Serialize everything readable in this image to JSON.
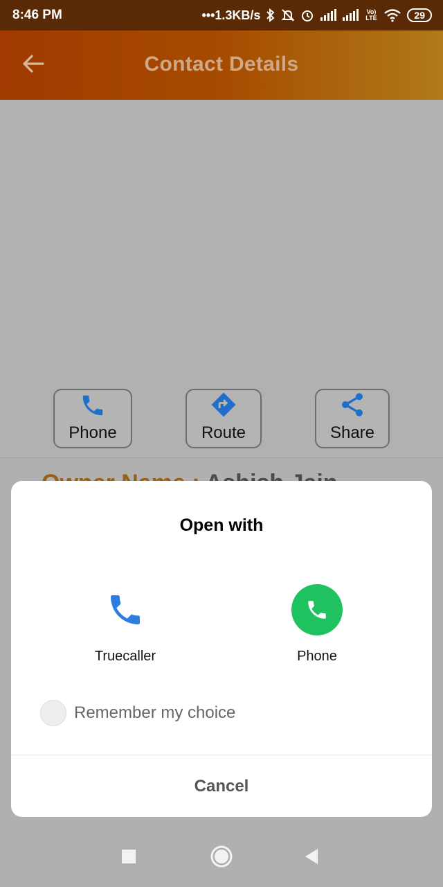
{
  "status_bar": {
    "time": "8:46 PM",
    "net_speed": "•••1.3KB/s",
    "volte_label": "Vo) LTE",
    "battery": "29",
    "icons": [
      "bluetooth-icon",
      "mute-icon",
      "alarm-icon",
      "signal-icon",
      "signal-icon",
      "volte-icon",
      "wifi-icon",
      "battery-icon"
    ]
  },
  "app_bar": {
    "title": "Contact Details",
    "back_icon": "arrow-left-icon"
  },
  "actions": [
    {
      "label": "Phone",
      "icon": "phone-icon"
    },
    {
      "label": "Route",
      "icon": "directions-icon"
    },
    {
      "label": "Share",
      "icon": "share-icon"
    }
  ],
  "owner_peek": {
    "key": "Owner Name : ",
    "value": "Ashish Jain"
  },
  "dialog": {
    "title": "Open with",
    "apps": [
      {
        "name": "Truecaller",
        "icon": "truecaller-phone-icon"
      },
      {
        "name": "Phone",
        "icon": "phone-app-icon"
      }
    ],
    "remember_label": "Remember my choice",
    "cancel_label": "Cancel"
  },
  "nav_bar": {
    "icons": [
      "recents-square-icon",
      "home-circle-icon",
      "back-triangle-icon"
    ]
  },
  "colors": {
    "app_bar_start": "#a03a00",
    "app_bar_end": "#b07a1a",
    "action_icon": "#1e6fc9",
    "phone_app_green": "#1fc25f",
    "truecaller_blue": "#2d7de0"
  }
}
